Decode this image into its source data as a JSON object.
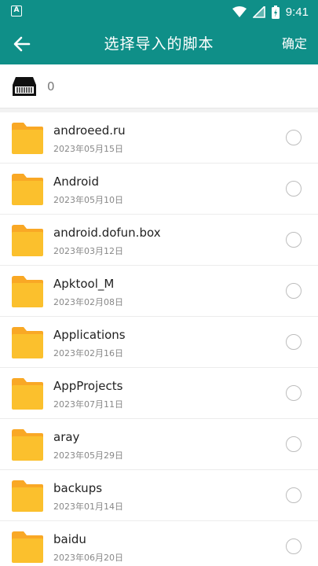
{
  "status_bar": {
    "notification_icon": "A",
    "time": "9:41",
    "icons": [
      "wifi-icon",
      "signal-icon",
      "battery-icon"
    ]
  },
  "toolbar": {
    "title": "选择导入的脚本",
    "confirm_label": "确定",
    "background_color": "#0f8f88"
  },
  "storage": {
    "icon": "sd-card-icon",
    "count": "0"
  },
  "files": [
    {
      "name": "androeed.ru",
      "date": "2023年05月15日"
    },
    {
      "name": "Android",
      "date": "2023年05月10日"
    },
    {
      "name": "android.dofun.box",
      "date": "2023年03月12日"
    },
    {
      "name": "Apktool_M",
      "date": "2023年02月08日"
    },
    {
      "name": "Applications",
      "date": "2023年02月16日"
    },
    {
      "name": "AppProjects",
      "date": "2023年07月11日"
    },
    {
      "name": "aray",
      "date": "2023年05月29日"
    },
    {
      "name": "backups",
      "date": "2023年01月14日"
    },
    {
      "name": "baidu",
      "date": "2023年06月20日"
    }
  ],
  "colors": {
    "accent": "#0f8f88",
    "folder": "#fbc02d",
    "folder_tab": "#f9a825"
  }
}
